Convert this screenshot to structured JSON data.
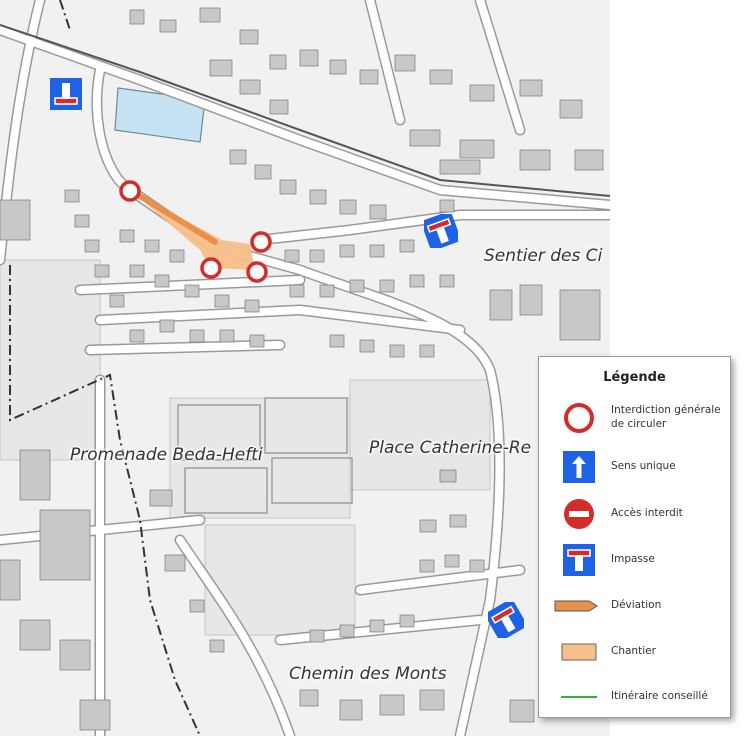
{
  "map": {
    "street_labels": [
      "Sentier des Ci",
      "Promenade Beda-Hefti",
      "Place Catherine-Re",
      "Chemin des Monts"
    ]
  },
  "legend": {
    "title": "Légende",
    "items": [
      {
        "label": "Interdiction générale de circuler",
        "icon": "no-entry-circle-icon"
      },
      {
        "label": "Sens unique",
        "icon": "one-way-arrow-icon"
      },
      {
        "label": "Accès interdit",
        "icon": "no-access-icon"
      },
      {
        "label": "Impasse",
        "icon": "dead-end-icon"
      },
      {
        "label": "Déviation",
        "icon": "detour-arrow-icon"
      },
      {
        "label": "Chantier",
        "icon": "construction-area-icon"
      },
      {
        "label": "Itinéraire conseillé",
        "icon": "recommended-route-icon"
      }
    ]
  },
  "colors": {
    "map_background": "#f1f1f1",
    "building_fill": "#c8c8c8",
    "road": "#ffffff",
    "sign_blue": "#1f62e6",
    "sign_red": "#d42b2b",
    "detour_orange": "#e8914a",
    "construction_fill": "#f7bf8a",
    "recommended_green": "#2cb53a"
  }
}
